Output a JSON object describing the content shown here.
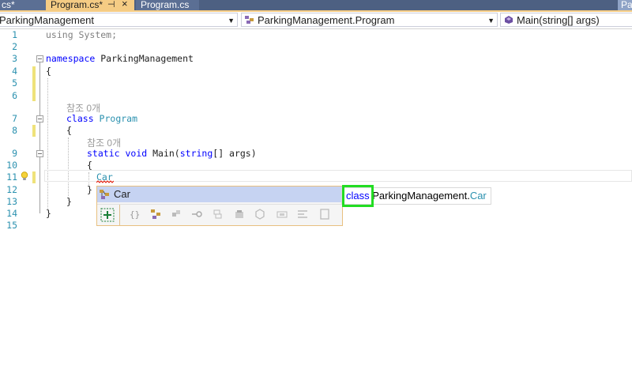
{
  "tabs": {
    "left": "cs*",
    "active": "Program.cs*",
    "active_pin": "⊣",
    "active_close": "×",
    "second": "Program.cs",
    "right": "Parking"
  },
  "nav": {
    "project": "ParkingManagement",
    "class": "ParkingManagement.Program",
    "member": "Main(string[] args)"
  },
  "editor": {
    "line_numbers": [
      "1",
      "2",
      "3",
      "4",
      "5",
      "6",
      "7",
      "8",
      "9",
      "10",
      "11",
      "12",
      "13",
      "14",
      "15"
    ],
    "lines": {
      "l1_using": "using",
      "l1_rest": " System;",
      "l3_ns_kw": "namespace",
      "l3_ns_name": " ParkingManagement",
      "l4": "{",
      "ref1": "참조 0개",
      "l7_kw": "class",
      "l7_name": " Program",
      "l8": "{",
      "ref2": "참조 0개",
      "l9_static": "static",
      "l9_void": " void",
      "l9_main": " Main(",
      "l9_string": "string",
      "l9_rest": "[] args)",
      "l10": "{",
      "l11_car": "Car",
      "l12": "}",
      "l13": "}",
      "l14": "}"
    }
  },
  "completion": {
    "selected_item": "Car",
    "quickinfo_kw": "class",
    "quickinfo_ns": " ParkingManagement.",
    "quickinfo_type": "Car"
  },
  "colors": {
    "keyword": "#0000ff",
    "type": "#2b91af",
    "highlight_box": "#22dd22"
  }
}
